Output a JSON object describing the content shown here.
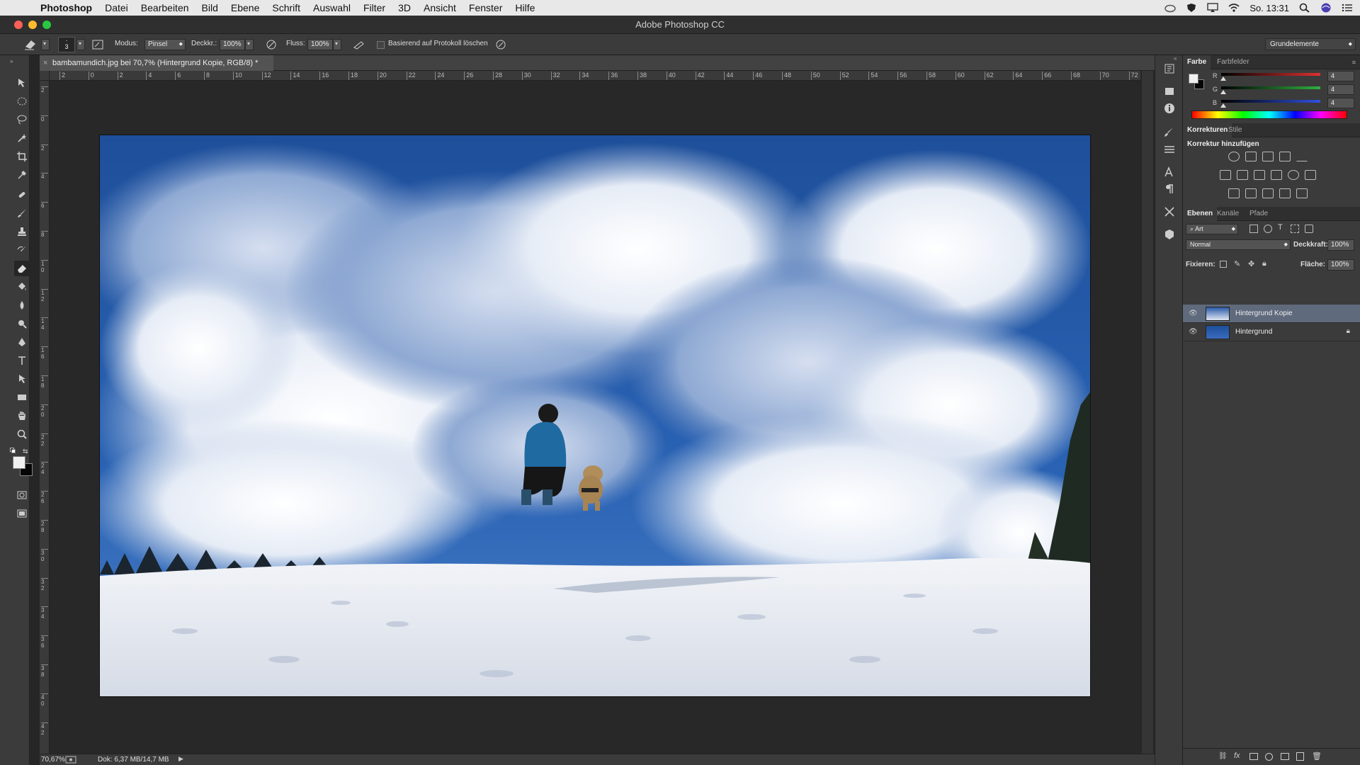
{
  "menubar": {
    "app": "Photoshop",
    "items": [
      "Datei",
      "Bearbeiten",
      "Bild",
      "Ebene",
      "Schrift",
      "Auswahl",
      "Filter",
      "3D",
      "Ansicht",
      "Fenster",
      "Hilfe"
    ],
    "clock": "So. 13:31"
  },
  "window": {
    "title": "Adobe Photoshop CC"
  },
  "options": {
    "brush_size": "3",
    "mode_label": "Modus:",
    "mode_value": "Pinsel",
    "opacity_label": "Deckkr.:",
    "opacity_value": "100%",
    "flow_label": "Fluss:",
    "flow_value": "100%",
    "history_label": "Basierend auf Protokoll löschen",
    "workspace": "Grundelemente"
  },
  "document": {
    "tab_title": "bambamundich.jpg bei 70,7% (Hintergrund Kopie, RGB/8) *"
  },
  "rulers": {
    "h_ticks": [
      "2",
      "0",
      "2",
      "4",
      "6",
      "8",
      "10",
      "12",
      "14",
      "16",
      "18",
      "20",
      "22",
      "24",
      "26",
      "28",
      "30",
      "32",
      "34",
      "36",
      "38",
      "40",
      "42",
      "44",
      "46",
      "48",
      "50",
      "52",
      "54",
      "56",
      "58",
      "60",
      "62",
      "64",
      "66",
      "68",
      "70",
      "72"
    ],
    "v_ticks": [
      "2",
      "0",
      "2",
      "4",
      "6",
      "8",
      "1 0",
      "1 2",
      "1 4",
      "1 6",
      "1 8",
      "2 0",
      "2 2",
      "2 4",
      "2 6",
      "2 8",
      "3 0",
      "3 2",
      "3 4",
      "3 6",
      "3 8",
      "4 0",
      "4 2"
    ]
  },
  "status": {
    "zoom": "70,67%",
    "doc": "Dok: 6,37 MB/14,7 MB"
  },
  "color_panel": {
    "tabs": [
      "Farbe",
      "Farbfelder"
    ],
    "channels": [
      {
        "label": "R",
        "value": "4",
        "color": "#e03030"
      },
      {
        "label": "G",
        "value": "4",
        "color": "#30b040"
      },
      {
        "label": "B",
        "value": "4",
        "color": "#3050e0"
      }
    ]
  },
  "adjust_panel": {
    "tabs": [
      "Korrekturen",
      "Stile"
    ],
    "heading": "Korrektur hinzufügen"
  },
  "layers_panel": {
    "tabs": [
      "Ebenen",
      "Kanäle",
      "Pfade"
    ],
    "filter": "Art",
    "blend": "Normal",
    "opacity_label": "Deckkraft:",
    "opacity_value": "100%",
    "lock_label": "Fixieren:",
    "fill_label": "Fläche:",
    "fill_value": "100%",
    "layers": [
      {
        "name": "Hintergrund Kopie",
        "selected": true
      },
      {
        "name": "Hintergrund",
        "selected": false
      }
    ]
  },
  "colors": {
    "accent": "#5f6a7d",
    "sky": "#2a5aa8"
  }
}
